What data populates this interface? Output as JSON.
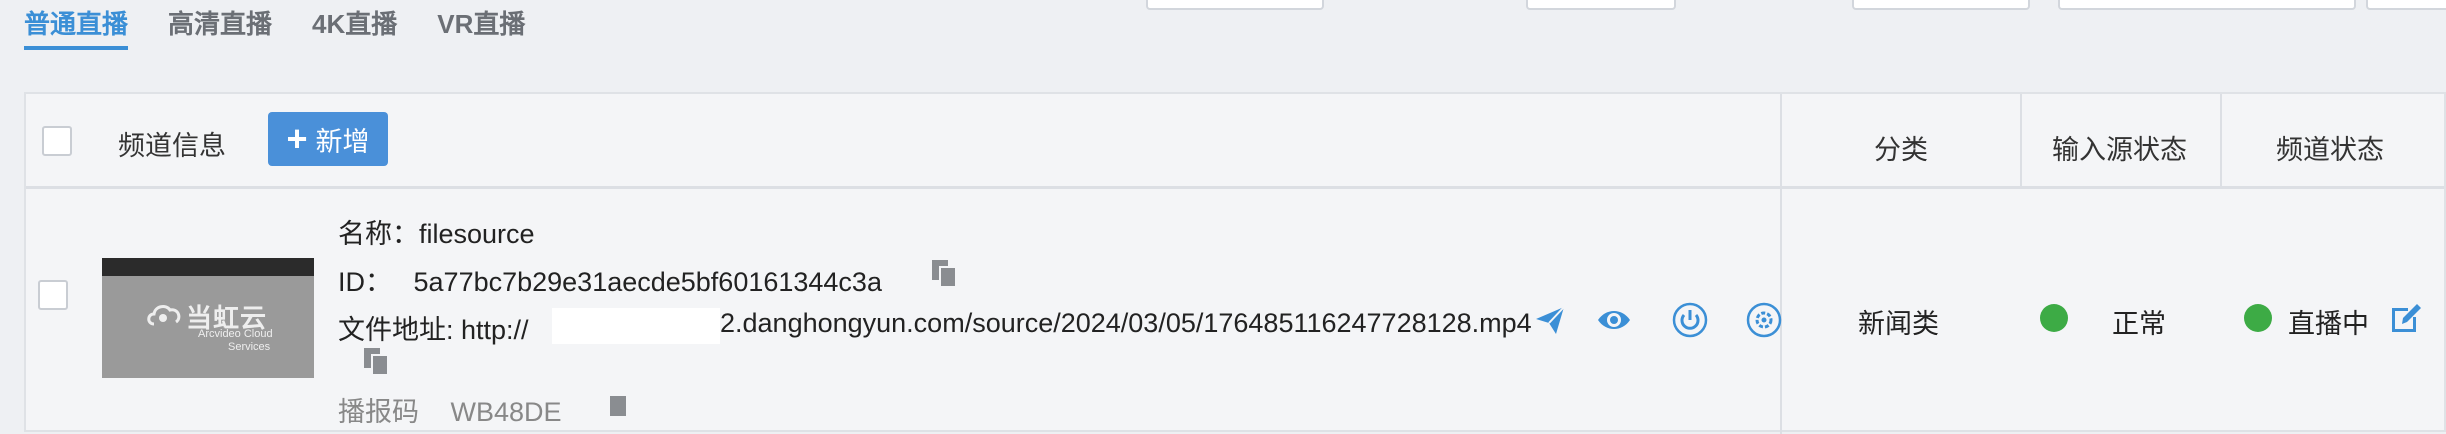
{
  "tabs": [
    {
      "label": "普通直播",
      "active": true
    },
    {
      "label": "高清直播",
      "active": false
    },
    {
      "label": "4K直播",
      "active": false
    },
    {
      "label": "VR直播",
      "active": false
    }
  ],
  "table": {
    "headers": {
      "channel_info": "频道信息",
      "add_button": "新增",
      "category": "分类",
      "input_status": "输入源状态",
      "channel_status": "频道状态"
    },
    "rows": [
      {
        "thumbnail": {
          "brand_zh": "当虹云",
          "brand_en_line1": "Arcvideo Cloud",
          "brand_en_line2": "Services"
        },
        "name_label": "名称：",
        "name_value": "filesource",
        "id_label": "ID：",
        "id_value": "5a77bc7b29e31aecde5bf60161344c3a",
        "file_label": "文件地址: http://",
        "file_value": "2.danghongyun.com/source/2024/03/05/176485116247728128",
        "file_suffix": ".mp4",
        "next_label_partial": "播报码",
        "next_value_partial": "WB48DE",
        "category": "新闻类",
        "input_status": "正常",
        "channel_status": "直播中",
        "status_color": "#3dab45"
      }
    ]
  },
  "accent_color": "#3b8fd6",
  "icons": [
    "plus-icon",
    "copy-icon",
    "send-icon",
    "eye-icon",
    "power-icon",
    "settings-icon",
    "edit-icon"
  ]
}
